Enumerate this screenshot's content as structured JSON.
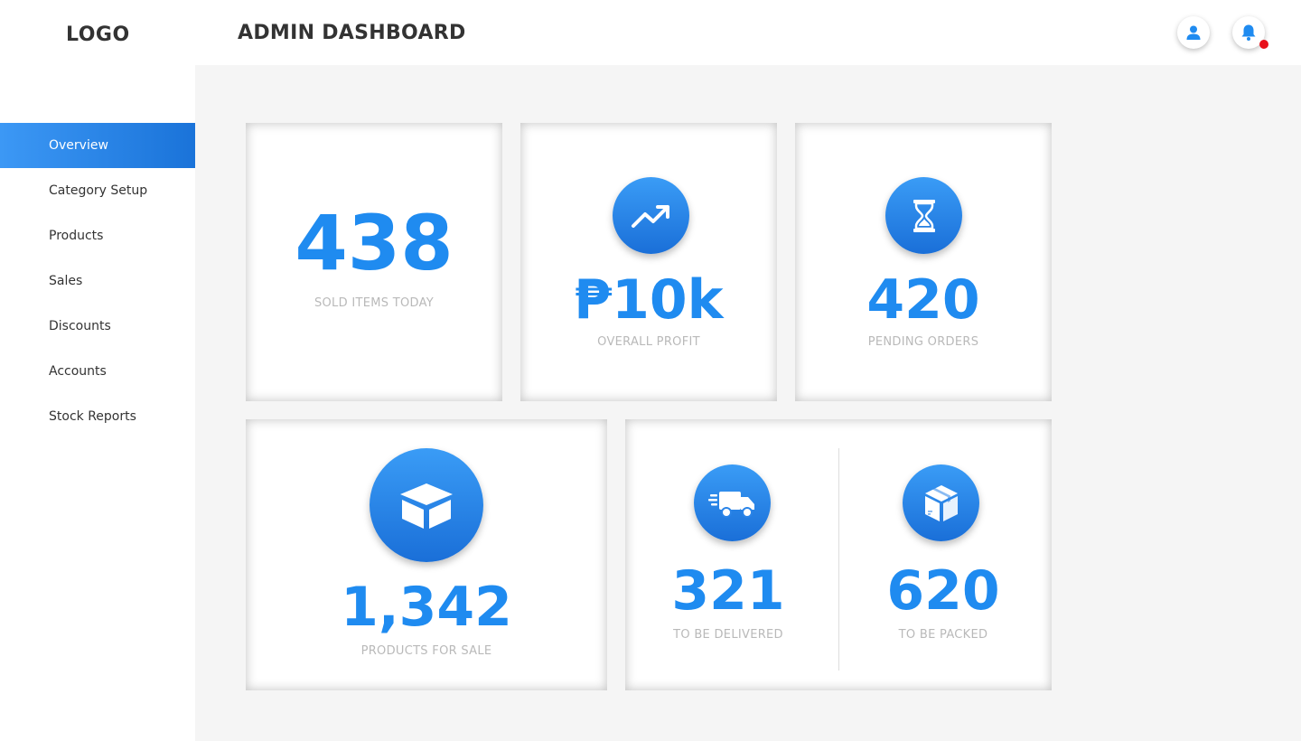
{
  "header": {
    "logo": "LOGO",
    "title": "ADMIN DASHBOARD",
    "icons": {
      "user": "user-icon",
      "bell": "bell-icon"
    },
    "notification_dot_color": "#e8101a"
  },
  "sidebar": {
    "items": [
      {
        "label": "Overview",
        "active": true
      },
      {
        "label": "Category Setup",
        "active": false
      },
      {
        "label": "Products",
        "active": false
      },
      {
        "label": "Sales",
        "active": false
      },
      {
        "label": "Discounts",
        "active": false
      },
      {
        "label": "Accounts",
        "active": false
      },
      {
        "label": "Stock Reports",
        "active": false
      }
    ]
  },
  "cards": {
    "sold": {
      "value": "438",
      "label": "SOLD ITEMS TODAY"
    },
    "profit": {
      "value": "₱10k",
      "label": "OVERALL PROFIT",
      "icon": "trending-up-icon"
    },
    "pending": {
      "value": "420",
      "label": "PENDING ORDERS",
      "icon": "hourglass-icon"
    },
    "products": {
      "value": "1,342",
      "label": "PRODUCTS FOR SALE",
      "icon": "open-box-icon"
    },
    "delivered": {
      "value": "321",
      "label": "TO BE DELIVERED",
      "icon": "delivery-truck-icon"
    },
    "packed": {
      "value": "620",
      "label": "TO BE PACKED",
      "icon": "package-icon"
    }
  },
  "colors": {
    "accent": "#1f8bf0",
    "active_nav_start": "#3c98f5",
    "active_nav_end": "#1a73d9",
    "caption": "#b9b9b9",
    "main_bg": "#f5f5f5"
  }
}
